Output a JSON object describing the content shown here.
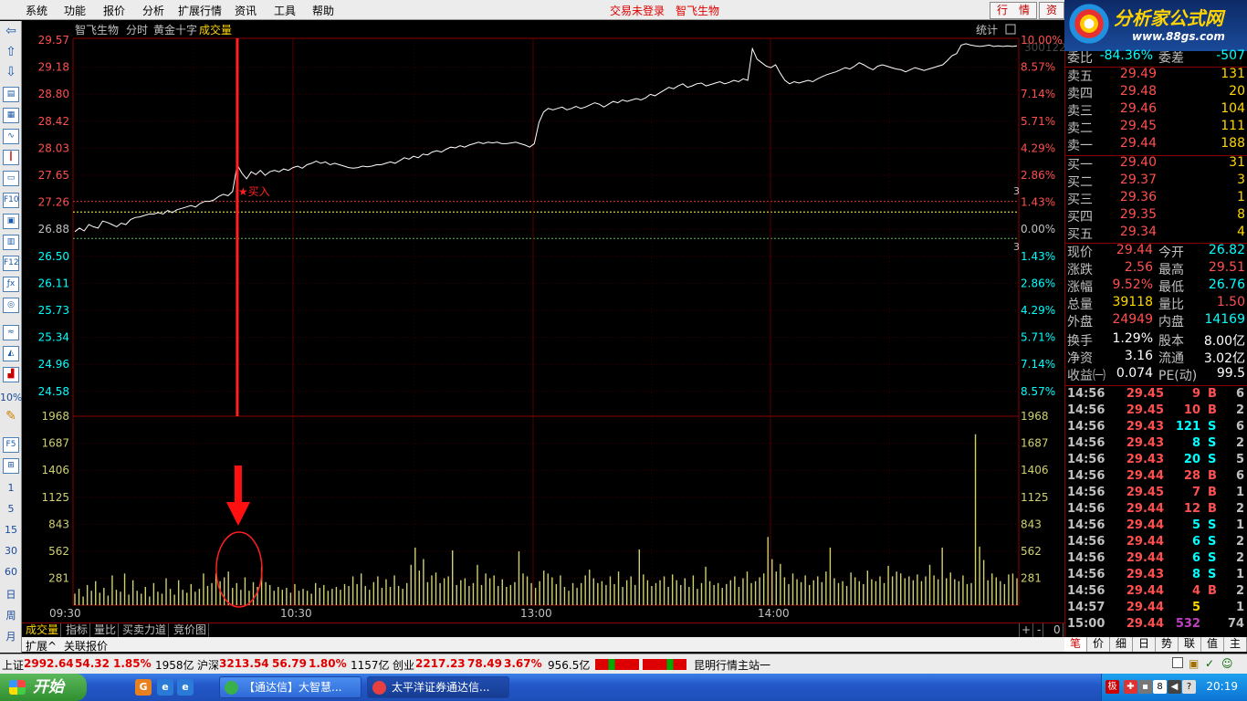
{
  "menu": [
    "系统",
    "功能",
    "报价",
    "分析",
    "扩展行情",
    "资讯",
    "工具",
    "帮助"
  ],
  "login_status": "交易未登录",
  "stock_title": "智飞生物",
  "top_buttons": [
    "行　情",
    "资"
  ],
  "logo": {
    "text": "分析家公式网",
    "url": "www.88gs.com"
  },
  "chart": {
    "header": {
      "name": "智飞生物",
      "mode": "分时",
      "cross": "黄金十字",
      "indicator": "成交量",
      "stats": "统计"
    },
    "code_overlay": "300122 智飞生物",
    "price_labels": [
      "29.57",
      "29.18",
      "28.80",
      "28.42",
      "28.03",
      "27.65",
      "27.26",
      "26.88",
      "26.50",
      "26.11",
      "25.73",
      "25.34",
      "24.96",
      "24.58"
    ],
    "pct_labels": [
      "10.00%",
      "8.57%",
      "7.14%",
      "5.71%",
      "4.29%",
      "2.86%",
      "1.43%",
      "0.00%",
      "1.43%",
      "2.86%",
      "4.29%",
      "5.71%",
      "7.14%",
      "8.57%"
    ],
    "vol_labels": [
      "1968",
      "1687",
      "1406",
      "1125",
      "843",
      "562",
      "281"
    ],
    "time_labels": [
      "09:30",
      "10:30",
      "13:00",
      "14:00"
    ],
    "buy_label": "★买入",
    "side_marks": [
      "3",
      "3"
    ],
    "volume_values": [
      120,
      170,
      90,
      210,
      150,
      250,
      130,
      180,
      100,
      310,
      160,
      140,
      330,
      110,
      260,
      150,
      120,
      190,
      90,
      230,
      140,
      120,
      280,
      170,
      110,
      260,
      160,
      130,
      220,
      140,
      170,
      330,
      200,
      230,
      330,
      250,
      290,
      350,
      180,
      230,
      160,
      290,
      150,
      240,
      190,
      400,
      240,
      210,
      150,
      190,
      160,
      180,
      130,
      220,
      150,
      170,
      150,
      120,
      230,
      180,
      210,
      150,
      170,
      190,
      160,
      220,
      200,
      300,
      220,
      330,
      200,
      160,
      240,
      300,
      180,
      270,
      190,
      310,
      200,
      170,
      230,
      420,
      600,
      360,
      480,
      240,
      310,
      340,
      230,
      280,
      300,
      570,
      210,
      260,
      280,
      200,
      230,
      420,
      210,
      330,
      280,
      310,
      200,
      270,
      190,
      210,
      240,
      560,
      330,
      300,
      230,
      180,
      250,
      360,
      330,
      290,
      220,
      310,
      190,
      150,
      230,
      180,
      230,
      310,
      370,
      280,
      230,
      250,
      210,
      300,
      220,
      350,
      190,
      260,
      300,
      210,
      580,
      320,
      260,
      200,
      230,
      260,
      300,
      190,
      320,
      260,
      210,
      280,
      190,
      310,
      170,
      230,
      400,
      250,
      210,
      230,
      180,
      220,
      260,
      300,
      190,
      280,
      350,
      230,
      250,
      290,
      330,
      710,
      480,
      350,
      430,
      290,
      220,
      330,
      270,
      240,
      310,
      210,
      260,
      300,
      240,
      350,
      600,
      280,
      230,
      250,
      200,
      340,
      290,
      250,
      220,
      360,
      270,
      250,
      300,
      230,
      410,
      300,
      350,
      330,
      280,
      300,
      260,
      320,
      250,
      300,
      420,
      310,
      270,
      600,
      280,
      340,
      270,
      250,
      310,
      220,
      230,
      1780,
      610,
      470,
      260,
      330,
      290,
      250,
      220,
      320,
      330,
      280
    ],
    "price_values": [
      26.85,
      26.9,
      26.86,
      26.95,
      26.92,
      26.9,
      27.0,
      26.98,
      26.95,
      26.92,
      26.97,
      26.95,
      27.02,
      27.05,
      27.06,
      27.08,
      27.1,
      27.1,
      27.12,
      27.1,
      27.15,
      27.12,
      27.16,
      27.18,
      27.2,
      27.22,
      27.2,
      27.25,
      27.28,
      27.28,
      27.3,
      27.35,
      27.38,
      27.36,
      27.42,
      27.8,
      27.68,
      27.6,
      27.7,
      27.66,
      27.72,
      27.65,
      27.7,
      27.72,
      27.7,
      27.74,
      27.72,
      27.76,
      27.78,
      27.75,
      27.8,
      27.82,
      27.85,
      27.82,
      27.84,
      27.8,
      27.82,
      27.8,
      27.78,
      27.76,
      27.75,
      27.76,
      27.78,
      27.77,
      27.78,
      27.8,
      27.8,
      27.82,
      27.84,
      27.82,
      27.86,
      27.9,
      27.88,
      27.92,
      27.9,
      27.95,
      27.94,
      27.98,
      28.0,
      27.98,
      28.02,
      28.05,
      28.04,
      28.07,
      28.05,
      28.08,
      28.1,
      28.12,
      28.1,
      28.12,
      28.11,
      28.12,
      28.1,
      28.1,
      28.11,
      28.12,
      28.1,
      28.08,
      28.05,
      28.1,
      28.4,
      28.55,
      28.6,
      28.58,
      28.6,
      28.62,
      28.58,
      28.6,
      28.63,
      28.6,
      28.62,
      28.65,
      28.68,
      28.66,
      28.62,
      28.66,
      28.7,
      28.68,
      28.72,
      28.7,
      28.72,
      28.74,
      28.72,
      28.75,
      28.8,
      28.78,
      28.82,
      28.86,
      28.9,
      28.88,
      28.92,
      28.95,
      28.9,
      28.92,
      28.95,
      28.96,
      28.92,
      28.94,
      28.96,
      28.98,
      28.95,
      28.97,
      29.0,
      28.98,
      29.02,
      29.0,
      29.45,
      29.3,
      29.25,
      29.2,
      29.18,
      29.22,
      29.1,
      29.0,
      28.95,
      28.98,
      28.96,
      28.98,
      29.0,
      28.98,
      29.02,
      29.05,
      29.08,
      29.1,
      29.12,
      29.15,
      29.18,
      29.16,
      29.2,
      29.25,
      29.22,
      29.18,
      29.15,
      29.2,
      29.22,
      29.2,
      29.18,
      29.16,
      29.15,
      29.12,
      29.15,
      29.18,
      29.16,
      29.14,
      29.16,
      29.18,
      29.2,
      29.22,
      29.28,
      29.35,
      29.38,
      29.5,
      29.52,
      29.5,
      29.49,
      29.48,
      29.49,
      29.5,
      29.48,
      29.49,
      29.48,
      29.49,
      29.48,
      29.49
    ],
    "first_buy_index": 35
  },
  "bottom_tabs": [
    "成交量",
    "指标",
    "量比",
    "买卖力道",
    "竞价图"
  ],
  "bottom_right_buttons": [
    "+",
    "-",
    "0"
  ],
  "ext_tabs": [
    "扩展^",
    "关联报价"
  ],
  "quote": {
    "weibi": {
      "label": "委比",
      "value": "-84.36%",
      "label2": "委差",
      "value2": "-507"
    },
    "asks": [
      {
        "label": "卖五",
        "price": "29.49",
        "vol": "131"
      },
      {
        "label": "卖四",
        "price": "29.48",
        "vol": "20"
      },
      {
        "label": "卖三",
        "price": "29.46",
        "vol": "104"
      },
      {
        "label": "卖二",
        "price": "29.45",
        "vol": "111"
      },
      {
        "label": "卖一",
        "price": "29.44",
        "vol": "188"
      }
    ],
    "bids": [
      {
        "label": "买一",
        "price": "29.40",
        "vol": "31"
      },
      {
        "label": "买二",
        "price": "29.37",
        "vol": "3"
      },
      {
        "label": "买三",
        "price": "29.36",
        "vol": "1"
      },
      {
        "label": "买四",
        "price": "29.35",
        "vol": "8"
      },
      {
        "label": "买五",
        "price": "29.34",
        "vol": "4"
      }
    ],
    "stats": [
      {
        "l1": "现价",
        "v1": "29.44",
        "c1": "#ff5050",
        "l2": "今开",
        "v2": "26.82",
        "c2": "#00ffff"
      },
      {
        "l1": "涨跌",
        "v1": "2.56",
        "c1": "#ff5050",
        "l2": "最高",
        "v2": "29.51",
        "c2": "#ff5050"
      },
      {
        "l1": "涨幅",
        "v1": "9.52%",
        "c1": "#ff5050",
        "l2": "最低",
        "v2": "26.76",
        "c2": "#00ffff"
      },
      {
        "l1": "总量",
        "v1": "39118",
        "c1": "#ffd700",
        "l2": "量比",
        "v2": "1.50",
        "c2": "#ff5050"
      },
      {
        "l1": "外盘",
        "v1": "24949",
        "c1": "#ff5050",
        "l2": "内盘",
        "v2": "14169",
        "c2": "#00ffff"
      },
      {
        "l1": "换手",
        "v1": "1.29%",
        "c1": "#ffffff",
        "l2": "股本",
        "v2": "8.00亿",
        "c2": "#ffffff"
      },
      {
        "l1": "净资",
        "v1": "3.16",
        "c1": "#ffffff",
        "l2": "流通",
        "v2": "3.02亿",
        "c2": "#ffffff"
      },
      {
        "l1": "收益㈠",
        "v1": "0.074",
        "c1": "#ffffff",
        "l2": "PE(动)",
        "v2": "99.5",
        "c2": "#ffffff"
      }
    ],
    "ticks": [
      {
        "time": "14:56",
        "price": "29.45",
        "vol": "9",
        "dir": "B",
        "cnt": "6"
      },
      {
        "time": "14:56",
        "price": "29.45",
        "vol": "10",
        "dir": "B",
        "cnt": "2"
      },
      {
        "time": "14:56",
        "price": "29.43",
        "vol": "121",
        "dir": "S",
        "cnt": "6"
      },
      {
        "time": "14:56",
        "price": "29.43",
        "vol": "8",
        "dir": "S",
        "cnt": "2"
      },
      {
        "time": "14:56",
        "price": "29.43",
        "vol": "20",
        "dir": "S",
        "cnt": "5"
      },
      {
        "time": "14:56",
        "price": "29.44",
        "vol": "28",
        "dir": "B",
        "cnt": "6"
      },
      {
        "time": "14:56",
        "price": "29.45",
        "vol": "7",
        "dir": "B",
        "cnt": "1"
      },
      {
        "time": "14:56",
        "price": "29.44",
        "vol": "12",
        "dir": "B",
        "cnt": "2"
      },
      {
        "time": "14:56",
        "price": "29.44",
        "vol": "5",
        "dir": "S",
        "cnt": "1"
      },
      {
        "time": "14:56",
        "price": "29.44",
        "vol": "6",
        "dir": "S",
        "cnt": "2"
      },
      {
        "time": "14:56",
        "price": "29.44",
        "vol": "6",
        "dir": "S",
        "cnt": "2"
      },
      {
        "time": "14:56",
        "price": "29.43",
        "vol": "8",
        "dir": "S",
        "cnt": "1"
      },
      {
        "time": "14:56",
        "price": "29.44",
        "vol": "4",
        "dir": "B",
        "cnt": "2"
      },
      {
        "time": "14:57",
        "price": "29.44",
        "vol": "5",
        "dir": "",
        "cnt": "1"
      },
      {
        "time": "15:00",
        "price": "29.44",
        "vol": "532",
        "dir": "",
        "cnt": "74"
      }
    ]
  },
  "rp_tabs": [
    "笔",
    "价",
    "细",
    "日",
    "势",
    "联",
    "值",
    "主"
  ],
  "status": {
    "sh_label": "上证",
    "sh_val": "2992.64",
    "sh_chg": "54.32",
    "sh_pct": "1.85%",
    "sh_amt": "1958亿",
    "sz_label": "沪深",
    "sz_val": "3213.54",
    "sz_chg": "56.79",
    "sz_pct": "1.80%",
    "sz_amt": "1157亿",
    "cy_label": "创业",
    "cy_val": "2217.23",
    "cy_chg": "78.49",
    "cy_pct": "3.67%",
    "cy_amt": "956.5亿",
    "server": "昆明行情主站一"
  },
  "taskbar": {
    "start": "开始",
    "tasks": [
      "【通达信】大智慧...",
      "太平洋证券通达信..."
    ],
    "clock": "20:19"
  },
  "colors": {
    "up": "#ff5050",
    "down": "#00ffff",
    "line": "#ffffff",
    "volume": "#d0d070",
    "grid": "#8b0000",
    "buy": "#ff2020"
  }
}
